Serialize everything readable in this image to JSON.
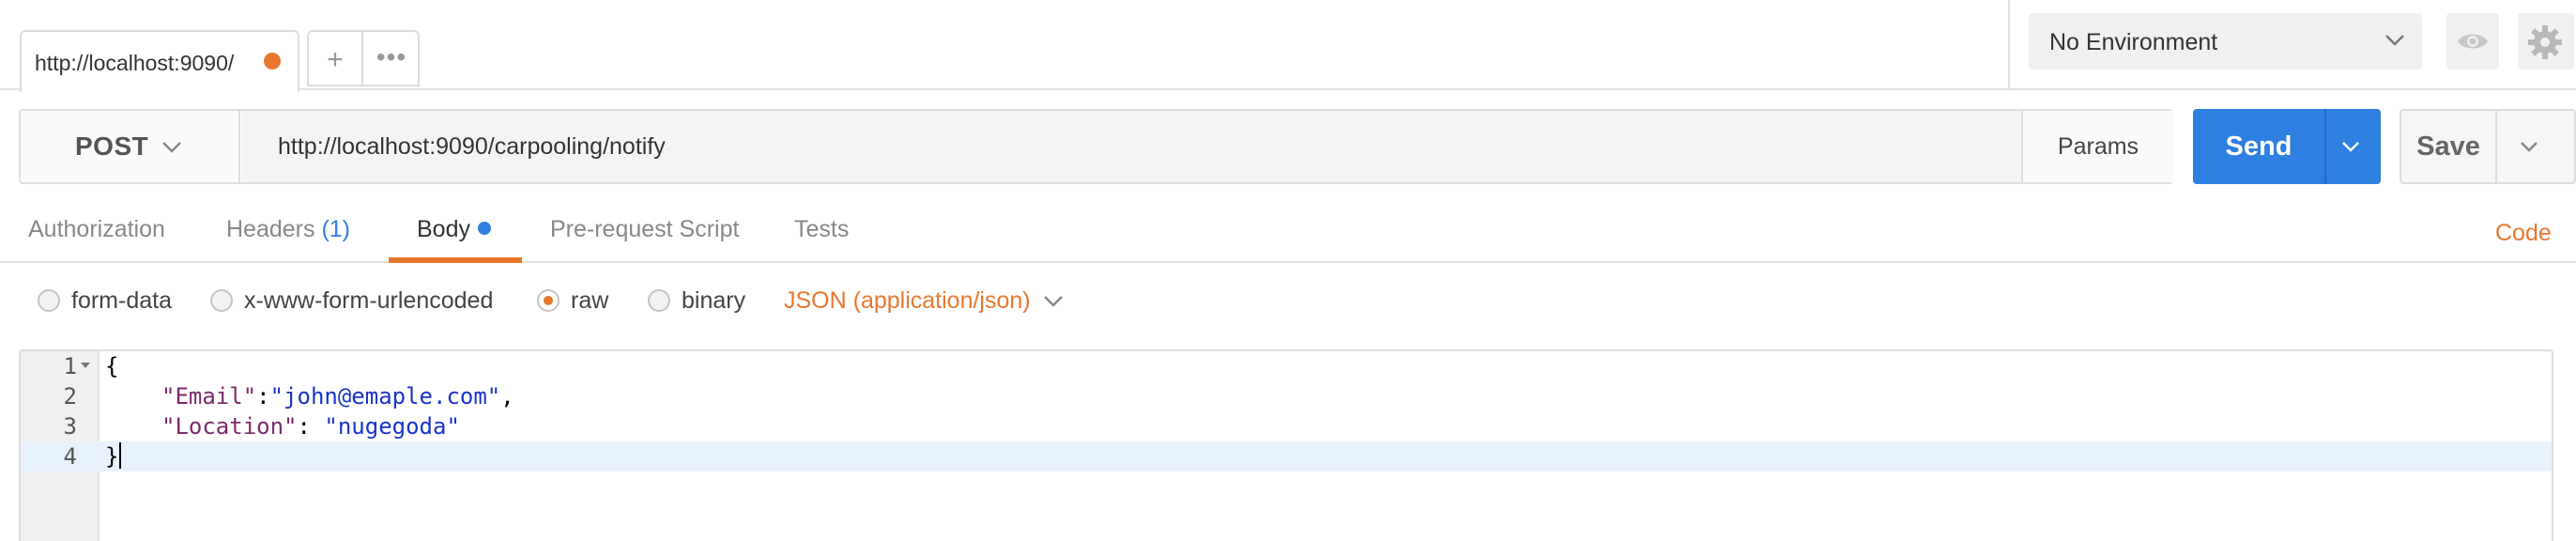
{
  "tabs": {
    "request_tab_title": "http://localhost:9090/",
    "new_tab_symbol": "+",
    "more_symbol": "•••"
  },
  "environment": {
    "selected": "No Environment"
  },
  "request": {
    "method": "POST",
    "url": "http://localhost:9090/carpooling/notify",
    "params_label": "Params",
    "send_label": "Send",
    "save_label": "Save"
  },
  "subtabs": {
    "authorization": "Authorization",
    "headers": "Headers",
    "headers_count": "(1)",
    "body": "Body",
    "prerequest": "Pre-request Script",
    "tests": "Tests",
    "code": "Code"
  },
  "body_types": {
    "form_data": "form-data",
    "urlencoded": "x-www-form-urlencoded",
    "raw": "raw",
    "binary": "binary",
    "selected": "raw",
    "content_type": "JSON (application/json)"
  },
  "editor": {
    "line_numbers": [
      "1",
      "2",
      "3",
      "4"
    ],
    "line1": "{",
    "line2_key": "\"Email\"",
    "line2_sep": ":",
    "line2_value": "\"john@emaple.com\"",
    "line2_end": ",",
    "line3_key": "\"Location\"",
    "line3_sep": ": ",
    "line3_value": "\"nugegoda\"",
    "line4": "}"
  },
  "colors": {
    "accent_orange": "#e8772e",
    "send_blue": "#2d7fe0",
    "json_key": "#7a2b6b",
    "json_string": "#1a34c9"
  }
}
